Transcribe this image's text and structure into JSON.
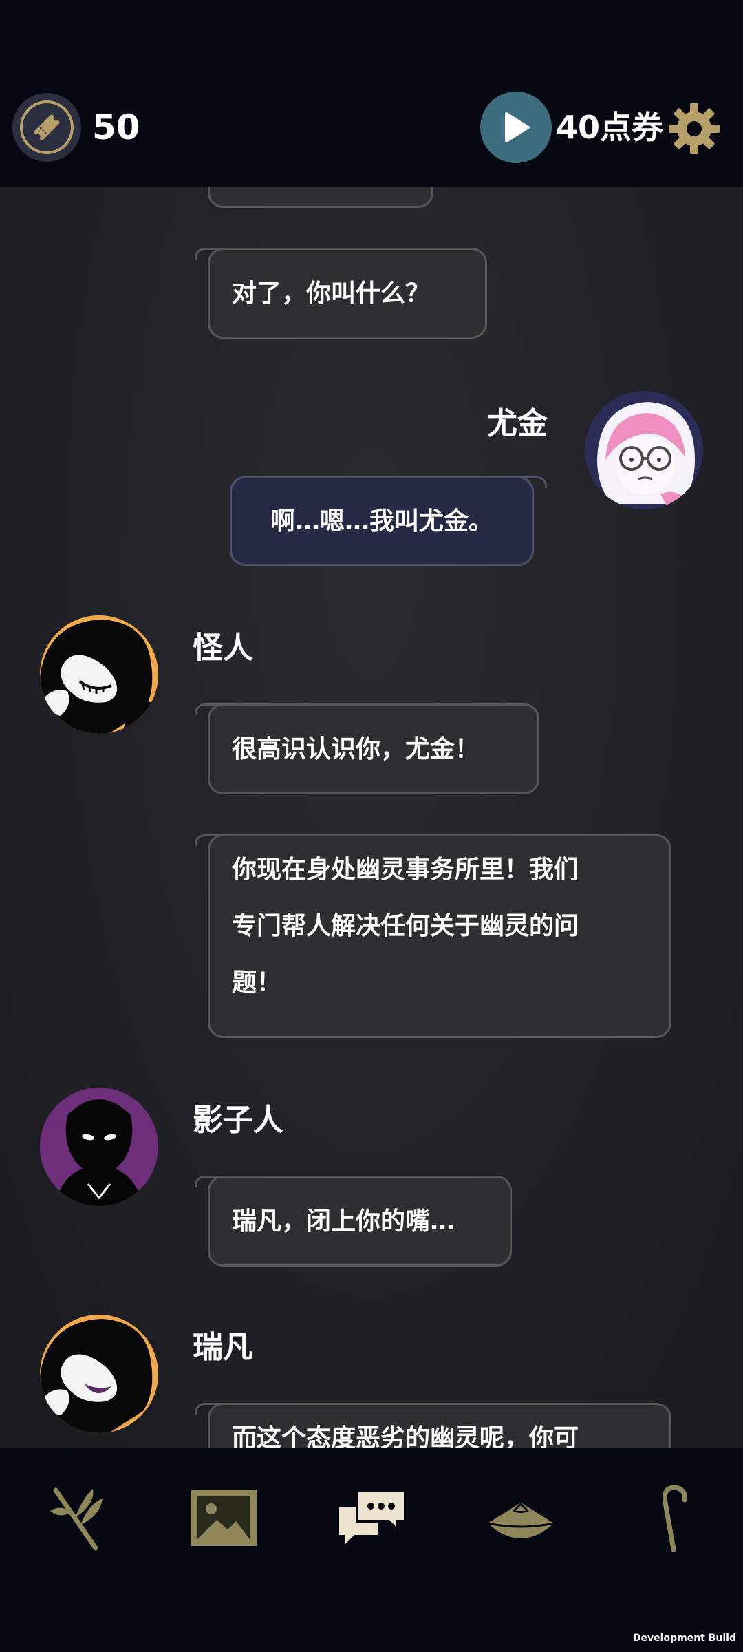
{
  "header": {
    "ticket_count": "50",
    "points_label": "40点券",
    "icons": [
      "ticket-icon",
      "play-icon",
      "gear-icon"
    ]
  },
  "chat": {
    "messages": [
      {
        "text": "对了，你叫什么？"
      },
      {
        "speaker": "尤金",
        "text": "啊…嗯…我叫尤金。"
      },
      {
        "speaker": "怪人",
        "text": "很高识认识你，尤金！"
      },
      {
        "lines": [
          "你现在身处幽灵事务所里！我们",
          "专门帮人解决任何关于幽灵的问",
          "题！"
        ]
      },
      {
        "speaker": "影子人",
        "text": "瑞凡，闭上你的嘴…"
      },
      {
        "speaker": "瑞凡",
        "text": "而这个态度恶劣的幽灵呢，你可"
      }
    ]
  },
  "nav": {
    "items": [
      "branch-icon",
      "gallery-icon",
      "chat-icon",
      "hat-icon",
      "cane-icon"
    ]
  },
  "footer": {
    "dev_build": "Development Build"
  },
  "colors": {
    "accent_gold": "#b79f6a",
    "play_teal": "#3b6d7e",
    "bubble": "#2f2f31",
    "my_bubble": "#262a44"
  }
}
